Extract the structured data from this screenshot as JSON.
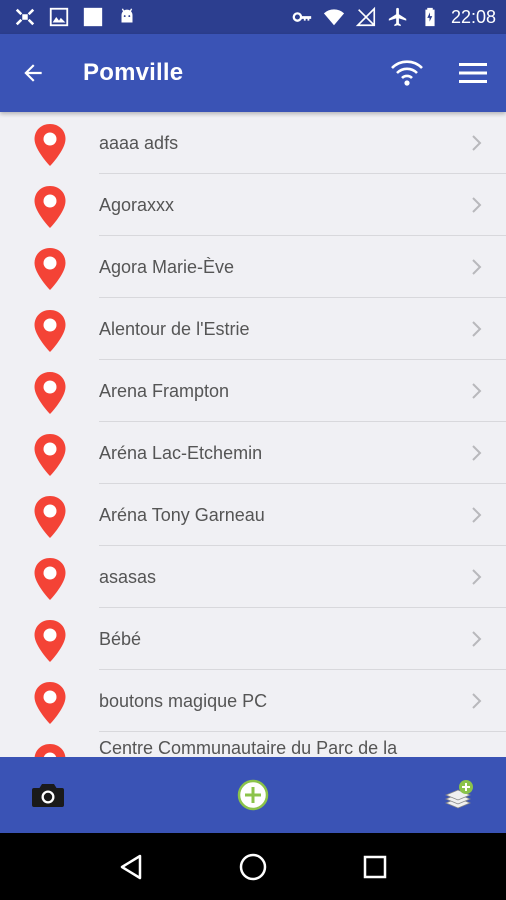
{
  "status_bar": {
    "time": "22:08",
    "left_icons": [
      "drone-notification-icon",
      "image-notification-icon",
      "square-notification-icon",
      "android-notification-icon"
    ],
    "right_icons": [
      "key-icon",
      "wifi-status-icon",
      "no-signal-icon",
      "airplane-mode-icon",
      "battery-icon"
    ]
  },
  "app_bar": {
    "title": "Pomville",
    "back_icon": "arrow-left-icon",
    "actions": [
      "wifi-icon",
      "menu-icon"
    ],
    "color": "#3a53b5"
  },
  "list": {
    "items": [
      {
        "label": "aaaa adfs"
      },
      {
        "label": "Agoraxxx"
      },
      {
        "label": "Agora Marie-Ève"
      },
      {
        "label": "Alentour de l'Estrie"
      },
      {
        "label": "Arena Frampton"
      },
      {
        "label": "Aréna Lac-Etchemin"
      },
      {
        "label": "Aréna Tony Garneau"
      },
      {
        "label": "asasas"
      },
      {
        "label": "Bébé"
      },
      {
        "label": "boutons magique PC"
      },
      {
        "label": "Centre Communautaire du Parc de la"
      }
    ],
    "pin_color": "#f44336"
  },
  "bottom_bar": {
    "actions": [
      "camera-icon",
      "add-circle-icon",
      "add-layers-icon"
    ],
    "add_color": "#8bc34a"
  },
  "nav_bar": {
    "buttons": [
      "back-triangle-icon",
      "home-circle-icon",
      "recents-square-icon"
    ]
  }
}
